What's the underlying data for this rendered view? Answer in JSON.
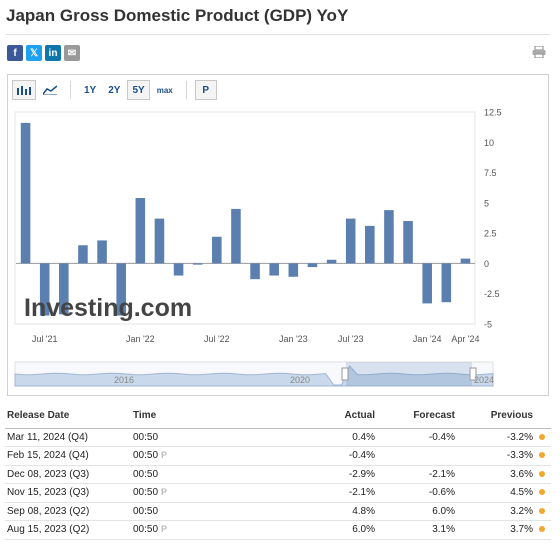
{
  "title": "Japan Gross Domestic Product (GDP) YoY",
  "share": {
    "facebook": "f",
    "twitter": "𝕏",
    "linkedin": "in",
    "email": "✉"
  },
  "toolbar": {
    "chart_icons": [
      "bar-chart-icon",
      "line-chart-icon"
    ],
    "ranges": [
      "1Y",
      "2Y",
      "5Y",
      "max"
    ],
    "active_range": "5Y",
    "p_label": "P"
  },
  "colors": {
    "bar": "#5b7fae",
    "positive": "#0ea600",
    "negative": "#ff0000",
    "dot": "#f0a830"
  },
  "watermark": "Investing.com",
  "chart_data": {
    "type": "bar",
    "values": [
      11.6,
      -4.3,
      -4.2,
      1.5,
      1.9,
      -4.3,
      5.4,
      3.7,
      -1.0,
      -0.1,
      2.2,
      4.5,
      -1.3,
      -1.0,
      -1.1,
      -0.3,
      0.3,
      3.7,
      3.1,
      4.4,
      3.5,
      -3.3,
      -3.2,
      0.4
    ],
    "ylim": [
      -5,
      12.5
    ],
    "y_ticks": [
      "12.5",
      "10",
      "7.5",
      "5",
      "2.5",
      "0",
      "-2.5",
      "-5"
    ],
    "x_ticks": [
      "Jul '21",
      "Jan '22",
      "Jul '22",
      "Jan '23",
      "Jul '23",
      "Jan '24",
      "Apr '24"
    ],
    "x_tick_bar_index": [
      1,
      6,
      10,
      14,
      17,
      21,
      23
    ],
    "navigator_labels": [
      "2016",
      "2020",
      "2024"
    ]
  },
  "table": {
    "headers": {
      "date": "Release Date",
      "time": "Time",
      "actual": "Actual",
      "forecast": "Forecast",
      "previous": "Previous"
    },
    "rows": [
      {
        "date": "Mar 11, 2024 (Q4)",
        "time": "00:50",
        "prelim": "",
        "actual": "0.4%",
        "actual_class": "pos",
        "forecast": "-0.4%",
        "previous": "-3.2%",
        "previous_class": "neg"
      },
      {
        "date": "Feb 15, 2024 (Q4)",
        "time": "00:50",
        "prelim": "P",
        "actual": "-0.4%",
        "actual_class": "",
        "forecast": "",
        "previous": "-3.3%",
        "previous_class": "neg"
      },
      {
        "date": "Dec 08, 2023 (Q3)",
        "time": "00:50",
        "prelim": "",
        "actual": "-2.9%",
        "actual_class": "neg",
        "forecast": "-2.1%",
        "previous": "3.6%",
        "previous_class": "neg"
      },
      {
        "date": "Nov 15, 2023 (Q3)",
        "time": "00:50",
        "prelim": "P",
        "actual": "-2.1%",
        "actual_class": "neg",
        "forecast": "-0.6%",
        "previous": "4.5%",
        "previous_class": "neg"
      },
      {
        "date": "Sep 08, 2023 (Q2)",
        "time": "00:50",
        "prelim": "",
        "actual": "4.8%",
        "actual_class": "neg",
        "forecast": "6.0%",
        "previous": "3.2%",
        "previous_class": "pos"
      },
      {
        "date": "Aug 15, 2023 (Q2)",
        "time": "00:50",
        "prelim": "P",
        "actual": "6.0%",
        "actual_class": "pos",
        "forecast": "3.1%",
        "previous": "3.7%",
        "previous_class": "pos"
      }
    ]
  }
}
